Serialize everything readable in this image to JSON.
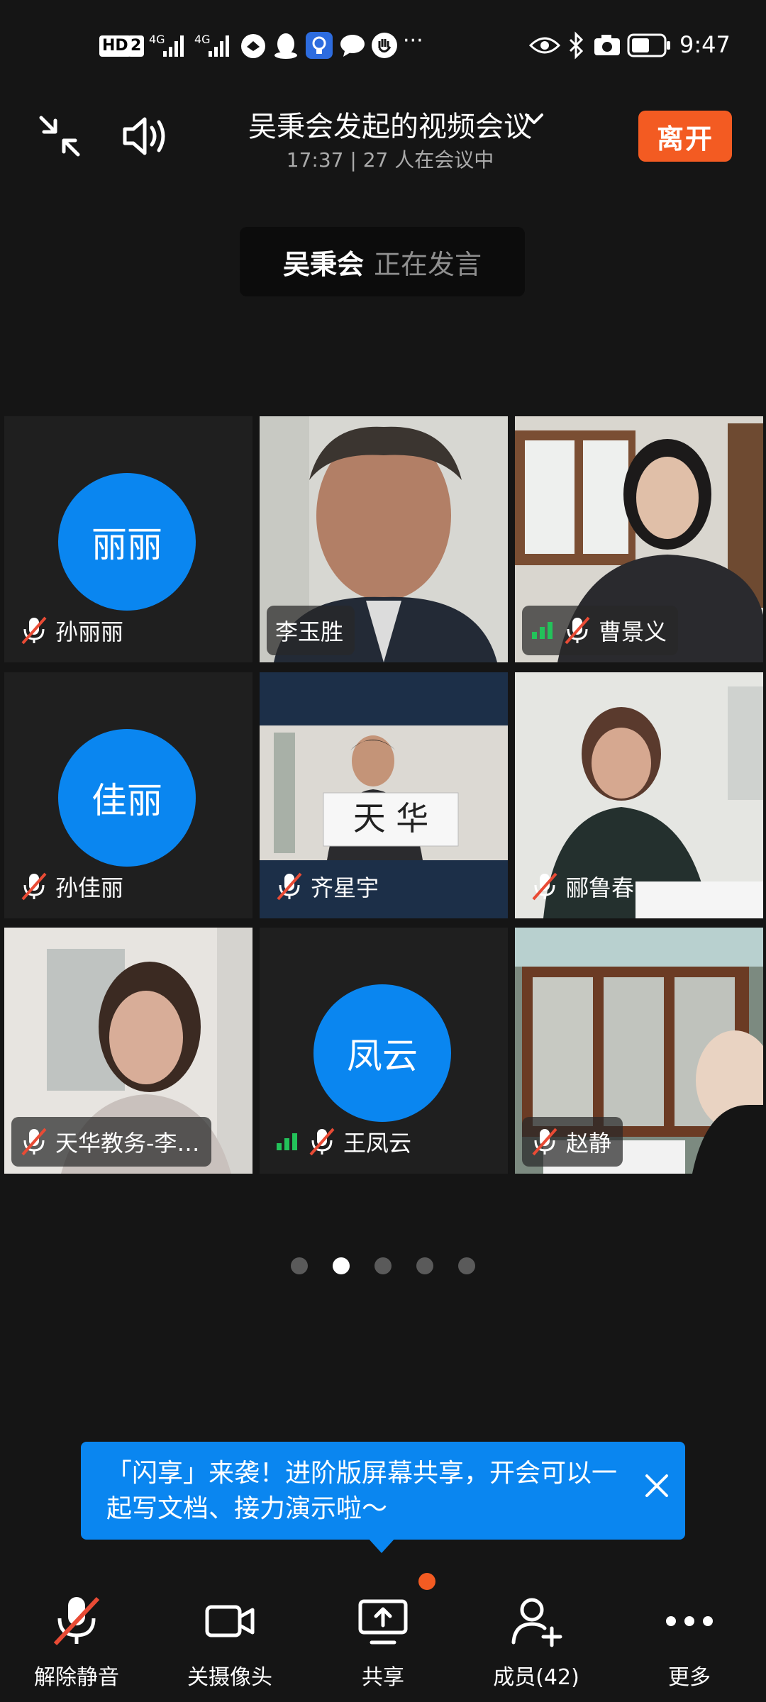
{
  "status_bar": {
    "time": "9:47",
    "hd_label": "HD",
    "sim_label": "2",
    "net1": "4G",
    "net2": "4G"
  },
  "header": {
    "title": "吴秉会发起的视频会议",
    "subtitle": "17:37 | 27 人在会议中",
    "leave_label": "离开"
  },
  "speaker": {
    "name": "吴秉会",
    "status": "正在发言"
  },
  "participants": [
    {
      "avatar_text": "丽丽",
      "name": "孙丽丽"
    },
    {
      "name": "李玉胜"
    },
    {
      "name": "曹景义"
    },
    {
      "avatar_text": "佳丽",
      "name": "孙佳丽"
    },
    {
      "name": "齐星宇",
      "sign_text": "天 华"
    },
    {
      "name": "郦鲁春"
    },
    {
      "name": "天华教务-李…"
    },
    {
      "avatar_text": "凤云",
      "name": "王凤云"
    },
    {
      "name": "赵静"
    }
  ],
  "pagination": {
    "total": 5,
    "active": 2
  },
  "tip": {
    "text": "「闪享」来袭！进阶版屏幕共享，开会可以一起写文档、接力演示啦～"
  },
  "toolbar": {
    "unmute_label": "解除静音",
    "camera_label": "关摄像头",
    "share_label": "共享",
    "members_label": "成员(42)",
    "more_label": "更多"
  },
  "colors": {
    "accent_blue": "#0a86f0",
    "leave_orange": "#f35b22",
    "mute_red": "#e94b35",
    "signal_green": "#23c25a"
  }
}
